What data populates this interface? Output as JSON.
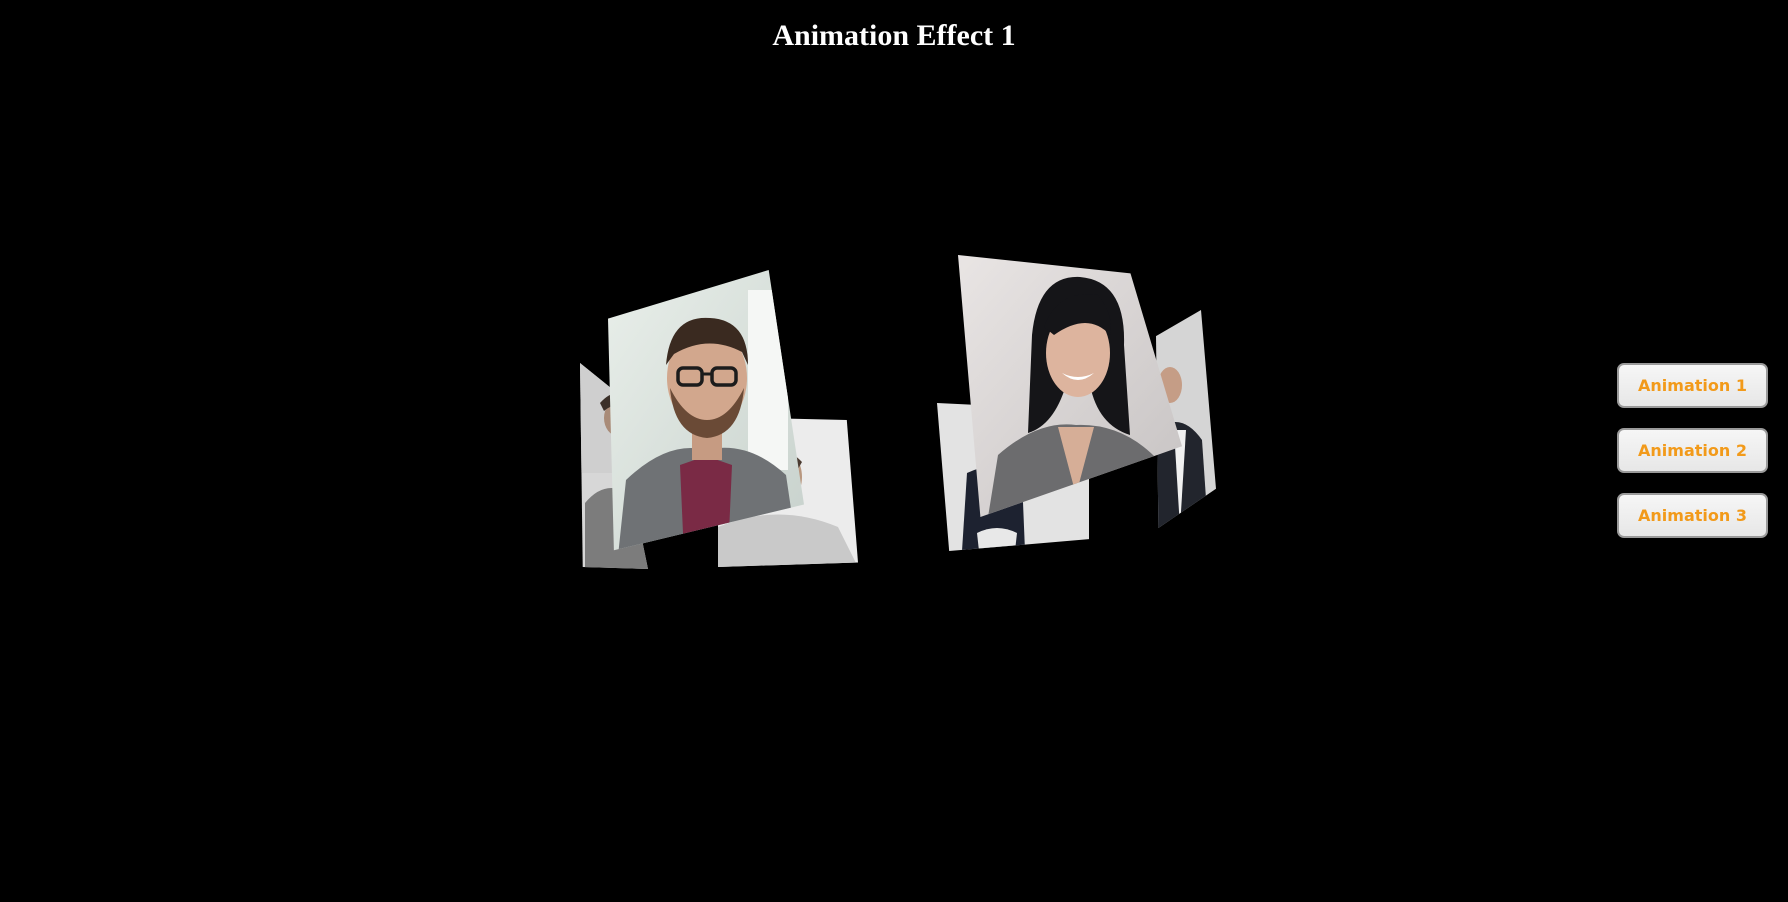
{
  "page": {
    "title": "Animation Effect 1"
  },
  "controls": {
    "buttons": [
      {
        "label": "Animation 1"
      },
      {
        "label": "Animation 2"
      },
      {
        "label": "Animation 3"
      }
    ]
  },
  "colors": {
    "background": "#000000",
    "title_text": "#ffffff",
    "button_text": "#f29a1a",
    "button_bg": "#f1f1f1",
    "button_border": "#9a9a9a"
  },
  "gallery": {
    "groups": [
      {
        "name": "left-cube",
        "main_portrait": "man-with-glasses-portrait"
      },
      {
        "name": "right-cube",
        "main_portrait": "smiling-woman-portrait"
      }
    ]
  }
}
